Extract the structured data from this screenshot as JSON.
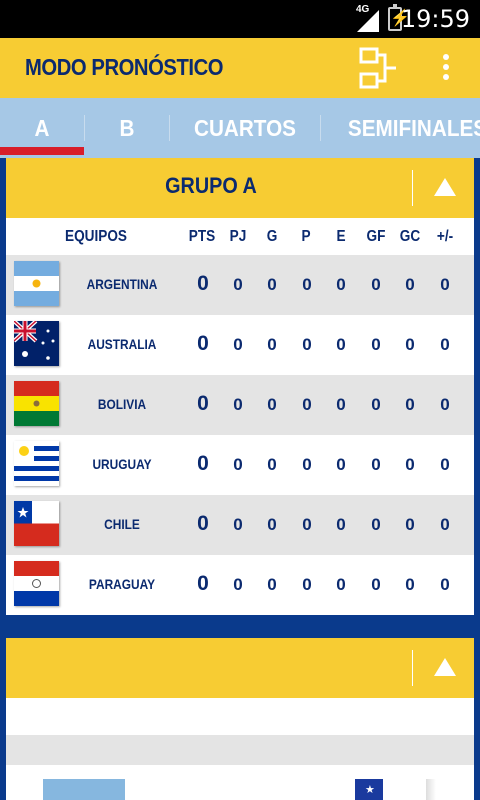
{
  "status": {
    "network": "4G",
    "time": "19:59"
  },
  "appbar": {
    "title": "MODO PRONÓSTICO",
    "bracket_icon": "bracket-icon",
    "menu_icon": "overflow-menu-icon"
  },
  "tabs": [
    {
      "label": "A",
      "selected": true
    },
    {
      "label": "B",
      "selected": false
    },
    {
      "label": "CUARTOS",
      "selected": false
    },
    {
      "label": "SEMIFINALES",
      "selected": false
    }
  ],
  "colors": {
    "accent": "#f7cc33",
    "primary": "#0b2a6f",
    "tab_bg": "#a6c8e6",
    "indicator": "#d81e2a",
    "background": "#0a3a8c"
  },
  "group": {
    "title": "GRUPO A",
    "columns": [
      "EQUIPOS",
      "PTS",
      "PJ",
      "G",
      "P",
      "E",
      "GF",
      "GC",
      "+/-"
    ],
    "rows": [
      {
        "team": "ARGENTINA",
        "flag": "argentina-flag",
        "stats": [
          "0",
          "0",
          "0",
          "0",
          "0",
          "0",
          "0",
          "0"
        ]
      },
      {
        "team": "AUSTRALIA",
        "flag": "australia-flag",
        "stats": [
          "0",
          "0",
          "0",
          "0",
          "0",
          "0",
          "0",
          "0"
        ]
      },
      {
        "team": "BOLIVIA",
        "flag": "bolivia-flag",
        "stats": [
          "0",
          "0",
          "0",
          "0",
          "0",
          "0",
          "0",
          "0"
        ]
      },
      {
        "team": "URUGUAY",
        "flag": "uruguay-flag",
        "stats": [
          "0",
          "0",
          "0",
          "0",
          "0",
          "0",
          "0",
          "0"
        ]
      },
      {
        "team": "CHILE",
        "flag": "chile-flag",
        "stats": [
          "0",
          "0",
          "0",
          "0",
          "0",
          "0",
          "0",
          "0"
        ]
      },
      {
        "team": "PARAGUAY",
        "flag": "paraguay-flag",
        "stats": [
          "0",
          "0",
          "0",
          "0",
          "0",
          "0",
          "0",
          "0"
        ]
      }
    ]
  },
  "group2": {
    "title": ""
  }
}
